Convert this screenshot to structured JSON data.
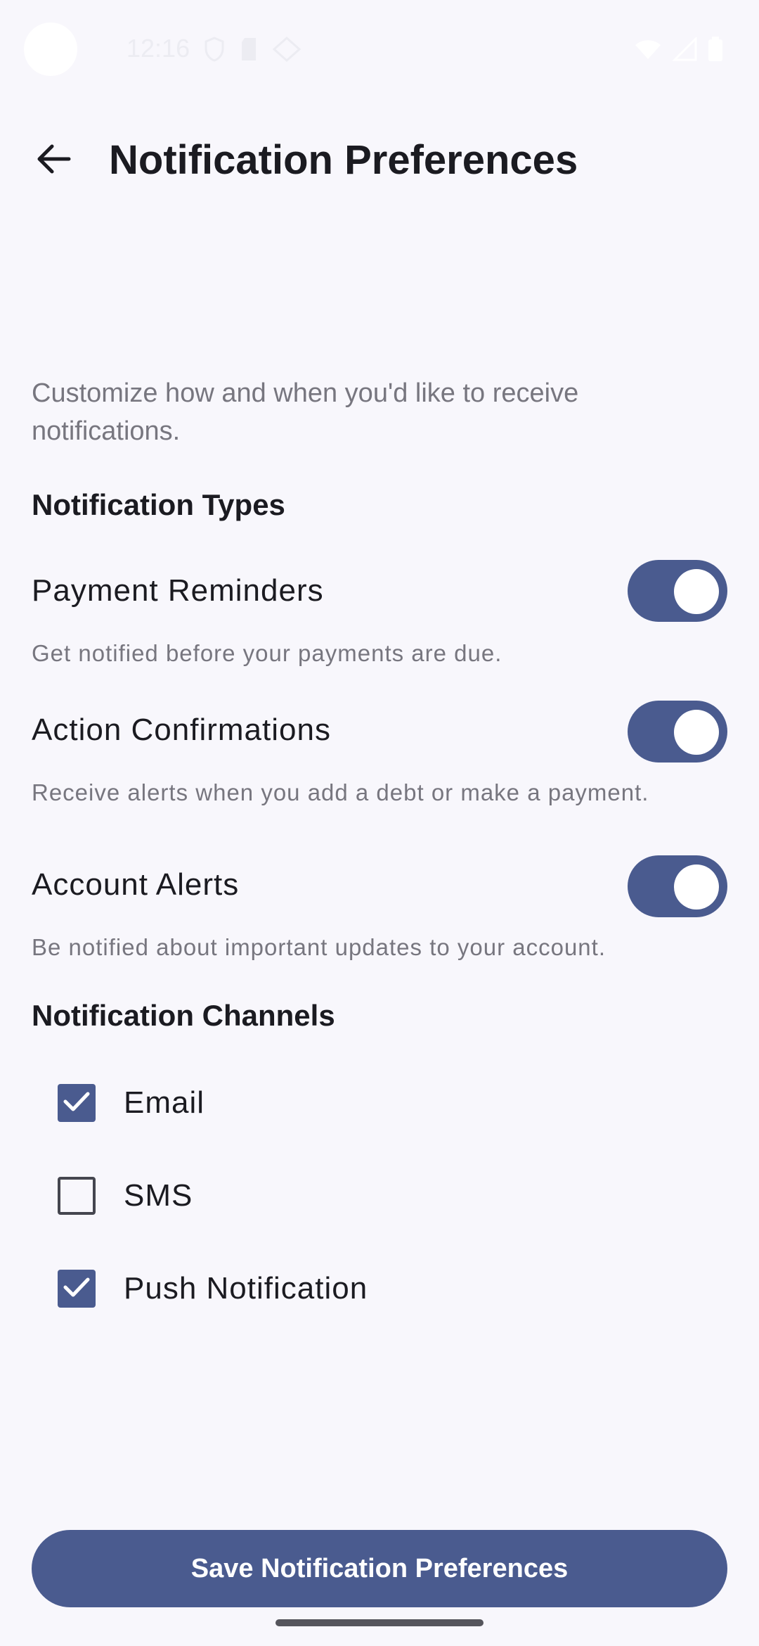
{
  "status_bar": {
    "time": "12:16"
  },
  "header": {
    "title": "Notification Preferences",
    "back_icon": "arrow-back-icon"
  },
  "intro_text": "Customize how and when you'd like to receive notifications.",
  "notification_types": {
    "heading": "Notification Types",
    "items": [
      {
        "label": "Payment Reminders",
        "description": "Get notified before your payments are due.",
        "enabled": true
      },
      {
        "label": "Action Confirmations",
        "description": "Receive alerts when you add a debt or make a payment.",
        "enabled": true
      },
      {
        "label": "Account Alerts",
        "description": "Be notified about important updates to your account.",
        "enabled": true
      }
    ]
  },
  "notification_channels": {
    "heading": "Notification Channels",
    "items": [
      {
        "label": "Email",
        "checked": true
      },
      {
        "label": "SMS",
        "checked": false
      },
      {
        "label": "Push Notification",
        "checked": true
      }
    ]
  },
  "save_button_label": "Save Notification Preferences",
  "colors": {
    "accent": "#4a5b8f",
    "background": "#f8f7fc",
    "text_primary": "#1b1b21",
    "text_secondary": "#77767f"
  }
}
